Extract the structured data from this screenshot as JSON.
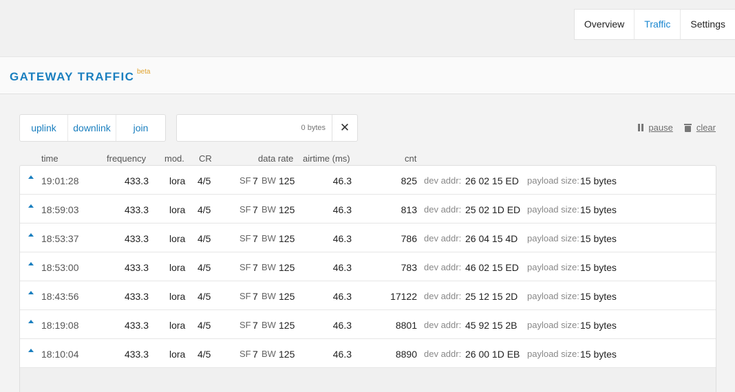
{
  "nav": {
    "tabs": [
      "Overview",
      "Traffic",
      "Settings"
    ],
    "active": "Traffic"
  },
  "header": {
    "title": "GATEWAY TRAFFIC",
    "badge": "beta"
  },
  "filters": [
    "uplink",
    "downlink",
    "join"
  ],
  "bytes_filter": {
    "placeholder": "0 bytes",
    "value": ""
  },
  "actions": {
    "pause": "pause",
    "clear": "clear"
  },
  "columns": {
    "time": "time",
    "frequency": "frequency",
    "mod": "mod.",
    "cr": "CR",
    "data_rate": "data rate",
    "airtime": "airtime (ms)",
    "cnt": "cnt"
  },
  "labels": {
    "sf": "SF",
    "bw": "BW",
    "dev_addr": "dev addr:",
    "payload_size": "payload size:"
  },
  "rows": [
    {
      "dir": "uplink",
      "time": "19:01:28",
      "frequency": "433.3",
      "mod": "lora",
      "cr": "4/5",
      "sf": "7",
      "bw": "125",
      "airtime": "46.3",
      "cnt": "825",
      "dev_addr": "26 02 15 ED",
      "payload": "15 bytes"
    },
    {
      "dir": "uplink",
      "time": "18:59:03",
      "frequency": "433.3",
      "mod": "lora",
      "cr": "4/5",
      "sf": "7",
      "bw": "125",
      "airtime": "46.3",
      "cnt": "813",
      "dev_addr": "25 02 1D ED",
      "payload": "15 bytes"
    },
    {
      "dir": "uplink",
      "time": "18:53:37",
      "frequency": "433.3",
      "mod": "lora",
      "cr": "4/5",
      "sf": "7",
      "bw": "125",
      "airtime": "46.3",
      "cnt": "786",
      "dev_addr": "26 04 15 4D",
      "payload": "15 bytes"
    },
    {
      "dir": "uplink",
      "time": "18:53:00",
      "frequency": "433.3",
      "mod": "lora",
      "cr": "4/5",
      "sf": "7",
      "bw": "125",
      "airtime": "46.3",
      "cnt": "783",
      "dev_addr": "46 02 15 ED",
      "payload": "15 bytes"
    },
    {
      "dir": "uplink",
      "time": "18:43:56",
      "frequency": "433.3",
      "mod": "lora",
      "cr": "4/5",
      "sf": "7",
      "bw": "125",
      "airtime": "46.3",
      "cnt": "17122",
      "dev_addr": "25 12 15 2D",
      "payload": "15 bytes"
    },
    {
      "dir": "uplink",
      "time": "18:19:08",
      "frequency": "433.3",
      "mod": "lora",
      "cr": "4/5",
      "sf": "7",
      "bw": "125",
      "airtime": "46.3",
      "cnt": "8801",
      "dev_addr": "45 92 15 2B",
      "payload": "15 bytes"
    },
    {
      "dir": "uplink",
      "time": "18:10:04",
      "frequency": "433.3",
      "mod": "lora",
      "cr": "4/5",
      "sf": "7",
      "bw": "125",
      "airtime": "46.3",
      "cnt": "8890",
      "dev_addr": "26 00 1D EB",
      "payload": "15 bytes"
    }
  ],
  "colors": {
    "accent": "#1a7fbf",
    "beta": "#e0a22d"
  }
}
